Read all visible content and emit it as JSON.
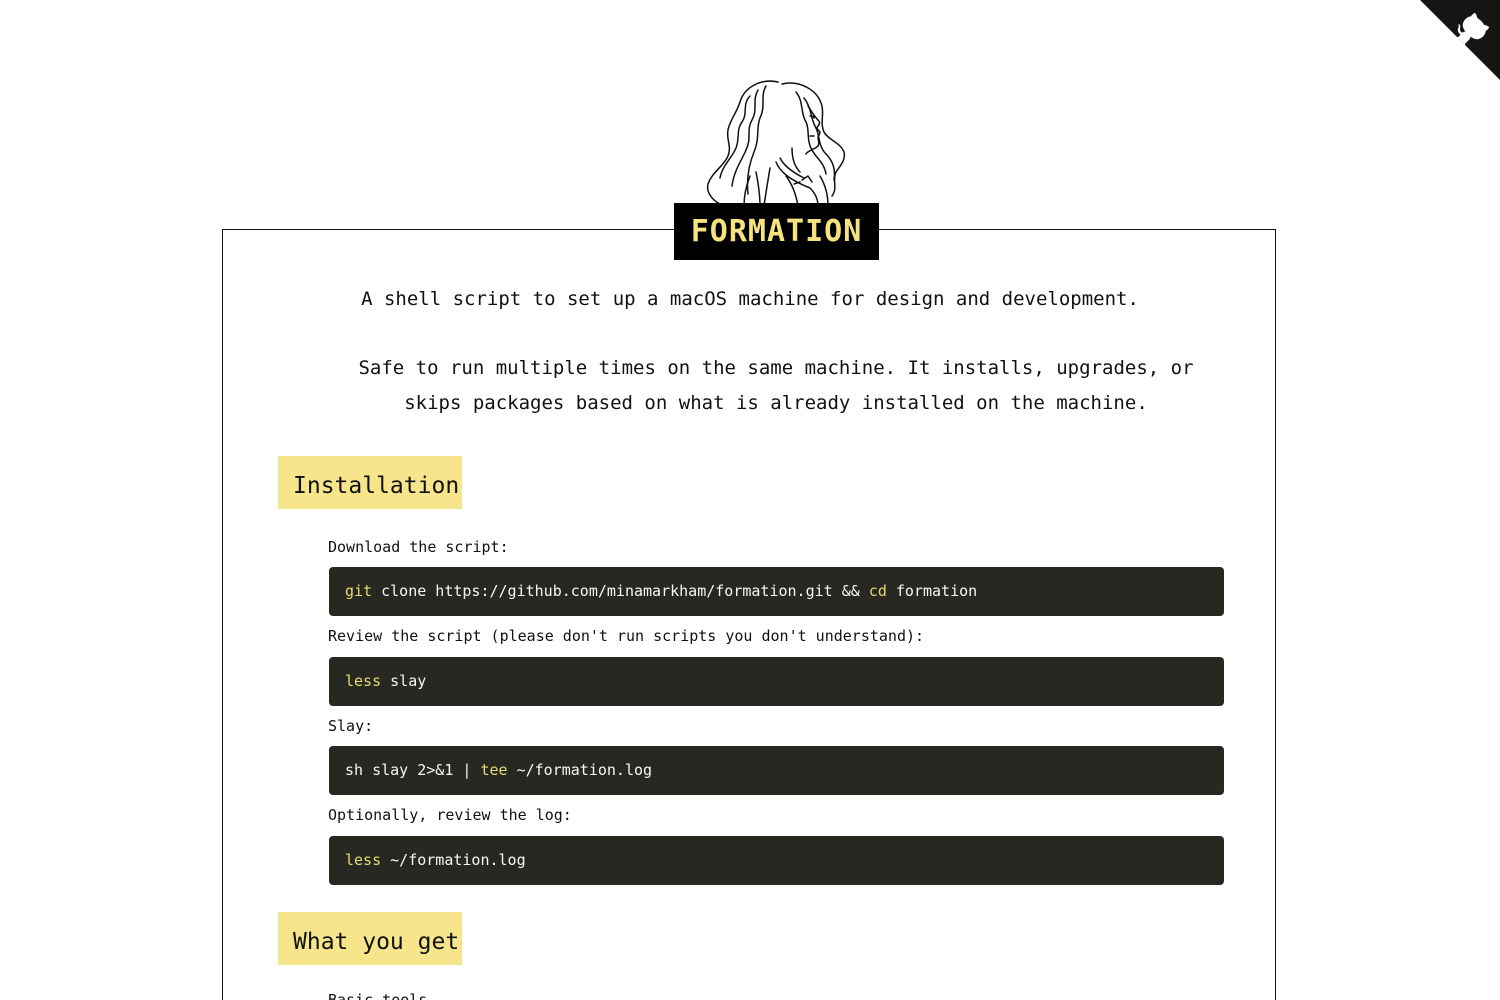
{
  "header": {
    "title": "FORMATION",
    "github_corner_icon": "github-octocat-icon",
    "illustration": "woman-portrait-line-drawing"
  },
  "intro": {
    "tagline": "A shell script to set up a macOS machine for design and development.",
    "description": "Safe to run multiple times on the same machine. It installs, upgrades, or skips packages based on what is already installed on the machine."
  },
  "installation": {
    "heading": "Installation",
    "steps": [
      {
        "label": "Download the script:",
        "code": [
          {
            "text": "git",
            "kw": true
          },
          {
            "text": " clone https://github.com/minamarkham/formation.git && ",
            "kw": false
          },
          {
            "text": "cd",
            "kw": true
          },
          {
            "text": " formation",
            "kw": false
          }
        ]
      },
      {
        "label": "Review the script (please don't run scripts you don't understand):",
        "code": [
          {
            "text": "less",
            "kw": true
          },
          {
            "text": " slay",
            "kw": false
          }
        ]
      },
      {
        "label": "Slay:",
        "code": [
          {
            "text": "sh slay 2>&1 | ",
            "kw": false
          },
          {
            "text": "tee",
            "kw": true
          },
          {
            "text": " ~/formation.log",
            "kw": false
          }
        ]
      },
      {
        "label": "Optionally, review the log:",
        "code": [
          {
            "text": "less",
            "kw": true
          },
          {
            "text": " ~/formation.log",
            "kw": false
          }
        ]
      }
    ]
  },
  "what_you_get": {
    "heading": "What you get",
    "first_item": "Basic tools"
  },
  "colors": {
    "accent": "#f6e58b",
    "title_text": "#f6e27f",
    "code_bg": "#272822",
    "code_keyword": "#e6db74"
  }
}
